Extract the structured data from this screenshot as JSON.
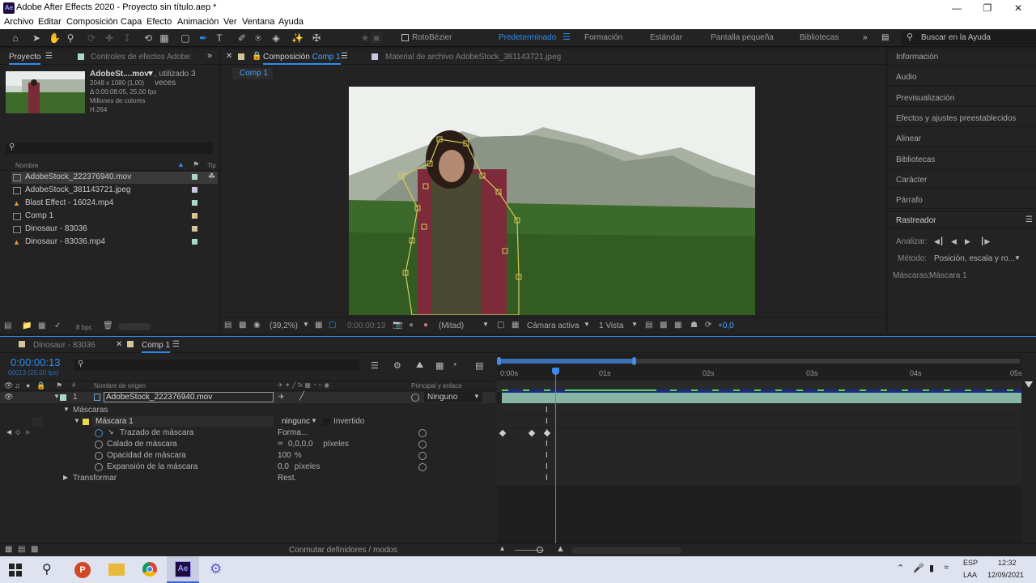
{
  "window": {
    "title": "Adobe After Effects 2020 - Proyecto sin título.aep *",
    "logo": "Ae",
    "minimize_icon": "minimize-icon",
    "maximize_icon": "maximize-icon",
    "close_icon": "close-icon"
  },
  "menu": [
    "Archivo",
    "Editar",
    "Composición",
    "Capa",
    "Efecto",
    "Animación",
    "Ver",
    "Ventana",
    "Ayuda"
  ],
  "toolbar": {
    "rotobezier_label": "RotoBézier",
    "workspaces": [
      "Predeterminado",
      "Formación",
      "Estándar",
      "Pantalla pequeña",
      "Bibliotecas"
    ],
    "active_workspace": "Predeterminado",
    "more_icon": "double-chevron-right-icon",
    "help_search_placeholder": "Buscar en la Ayuda"
  },
  "project_panel": {
    "tab_project": "Proyecto",
    "tab_effects": "Controles de efectos AdobeSt",
    "selected_name": "AdobeSt....mov",
    "used_text": ", utilizado 3 veces",
    "resolution": "2048 x 1080 (1,00)",
    "duration": "Δ 0:00:08:05, 25,00 fps",
    "colors": "Millones de colores",
    "codec": "H.264",
    "col_name": "Nombre",
    "col_type": "Tip",
    "bpc": "8 bpc",
    "items": [
      {
        "name": "AdobeStock_222376940.mov",
        "color": "#a8d8c8",
        "selected": true
      },
      {
        "name": "AdobeStock_381143721.jpeg",
        "color": "#c6c6e8",
        "selected": false
      },
      {
        "name": "Blast Effect - 16024.mp4",
        "color": "#a8d8c8",
        "selected": false
      },
      {
        "name": "Comp 1",
        "color": "#d4c49c",
        "selected": false
      },
      {
        "name": "Dinosaur - 83036",
        "color": "#d4c49c",
        "selected": false
      },
      {
        "name": "Dinosaur - 83036.mp4",
        "color": "#a8d8c8",
        "selected": false
      }
    ]
  },
  "comp_panel": {
    "tab_prefix": "Composición",
    "tab_comp": "Comp 1",
    "footage_tab": "Material de archivo  AdobeStock_381143721.jpeg",
    "breadcrumb": "Comp 1",
    "zoom": "(39,2%)",
    "timecode": "0:00:00:13",
    "resolution": "(Mitad)",
    "camera": "Cámara activa",
    "views": "1 Vista",
    "exposure": "+0,0"
  },
  "right_panel": {
    "items": [
      "Información",
      "Audio",
      "Previsualización",
      "Efectos y ajustes preestablecidos",
      "Alinear",
      "Bibliotecas",
      "Carácter",
      "Párrafo"
    ],
    "tracker_title": "Rastreador",
    "analyze_label": "Analizar:",
    "method_label": "Método:",
    "method_value": "Posición, escala y ro...",
    "masks_label": "Máscaras:",
    "masks_value": "Máscara 1"
  },
  "timeline": {
    "tabs": [
      {
        "label": "Dinosaur - 83036",
        "active": false
      },
      {
        "label": "Comp 1",
        "active": true
      }
    ],
    "timecode": "0:00:00:13",
    "frames": "00013 (25.00 fps)",
    "col_source": "Nombre de origen",
    "col_parent": "Principal y enlace",
    "layer_index": "1",
    "layer_name": "AdobeStock_222376940.mov",
    "parent_value": "Ninguno",
    "masks_group": "Máscaras",
    "mask_name": "Máscara 1",
    "mask_mode": "ningunc",
    "inverted_label": "Invertido",
    "properties": [
      {
        "name": "Trazado de máscara",
        "value": "Forma..."
      },
      {
        "name": "Calado de máscara",
        "value": "0,0,0,0",
        "unit": "píxeles"
      },
      {
        "name": "Opacidad de máscara",
        "value": "100",
        "unit": "%"
      },
      {
        "name": "Expansión de la máscara",
        "value": "0,0",
        "unit": "píxeles"
      }
    ],
    "transform_label": "Transformar",
    "transform_value": "Rest.",
    "ruler": [
      "0:00s",
      "01s",
      "02s",
      "03s",
      "04s",
      "05s"
    ],
    "switches_label": "Conmutar definidores / modos"
  },
  "taskbar": {
    "apps": [
      "windows-icon",
      "search-icon",
      "powerpoint-icon",
      "explorer-icon",
      "chrome-icon",
      "aftereffects-icon",
      "settings-icon"
    ],
    "lang": "ESP",
    "layout": "LAA",
    "time": "12:32",
    "date": "12/09/2021"
  }
}
